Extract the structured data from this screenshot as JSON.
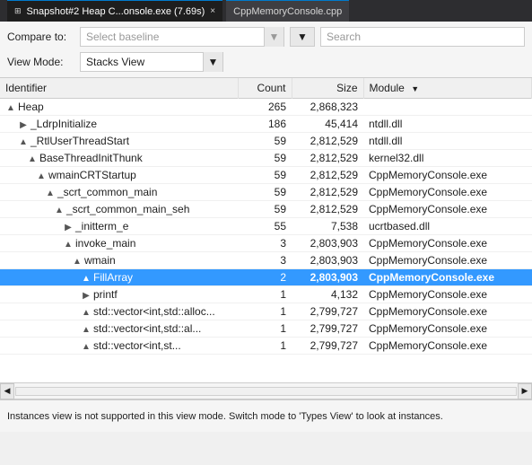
{
  "titlebar": {
    "tab1_label": "Snapshot#2 Heap C...onsole.exe (7.69s)",
    "tab1_pin": "⊞",
    "tab1_close": "×",
    "tab2_label": "CppMemoryConsole.cpp"
  },
  "toolbar": {
    "compare_label": "Compare to:",
    "compare_placeholder": "Select baseline",
    "view_label": "View Mode:",
    "view_value": "Stacks View",
    "search_placeholder": "Search",
    "filter_icon": "▼",
    "dropdown_arrow": "▼"
  },
  "table": {
    "columns": [
      "Identifier",
      "Count",
      "Size",
      "Module"
    ],
    "rows": [
      {
        "indent": 0,
        "expand": "▲",
        "name": "Heap",
        "count": "265",
        "size": "2,868,323",
        "module": "",
        "selected": false
      },
      {
        "indent": 1,
        "expand": "▶",
        "name": "_LdrpInitialize",
        "count": "186",
        "size": "45,414",
        "module": "ntdll.dll",
        "selected": false
      },
      {
        "indent": 1,
        "expand": "▲",
        "name": "_RtlUserThreadStart",
        "count": "59",
        "size": "2,812,529",
        "module": "ntdll.dll",
        "selected": false
      },
      {
        "indent": 2,
        "expand": "▲",
        "name": "BaseThreadInitThunk",
        "count": "59",
        "size": "2,812,529",
        "module": "kernel32.dll",
        "selected": false
      },
      {
        "indent": 3,
        "expand": "▲",
        "name": "wmainCRTStartup",
        "count": "59",
        "size": "2,812,529",
        "module": "CppMemoryConsole.exe",
        "selected": false
      },
      {
        "indent": 4,
        "expand": "▲",
        "name": "_scrt_common_main",
        "count": "59",
        "size": "2,812,529",
        "module": "CppMemoryConsole.exe",
        "selected": false
      },
      {
        "indent": 5,
        "expand": "▲",
        "name": "_scrt_common_main_seh",
        "count": "59",
        "size": "2,812,529",
        "module": "CppMemoryConsole.exe",
        "selected": false
      },
      {
        "indent": 6,
        "expand": "▶",
        "name": "_initterm_e",
        "count": "55",
        "size": "7,538",
        "module": "ucrtbased.dll",
        "selected": false
      },
      {
        "indent": 6,
        "expand": "▲",
        "name": "invoke_main",
        "count": "3",
        "size": "2,803,903",
        "module": "CppMemoryConsole.exe",
        "selected": false
      },
      {
        "indent": 7,
        "expand": "▲",
        "name": "wmain",
        "count": "3",
        "size": "2,803,903",
        "module": "CppMemoryConsole.exe",
        "selected": false
      },
      {
        "indent": 8,
        "expand": "▲",
        "name": "FillArray",
        "count": "2",
        "size": "2,803,903",
        "module": "CppMemoryConsole.exe",
        "selected": true
      },
      {
        "indent": 8,
        "expand": "▶",
        "name": "printf",
        "count": "1",
        "size": "4,132",
        "module": "CppMemoryConsole.exe",
        "selected": false
      },
      {
        "indent": 8,
        "expand": "▲",
        "name": "std::vector<int,std::alloc...",
        "count": "1",
        "size": "2,799,727",
        "module": "CppMemoryConsole.exe",
        "selected": false
      },
      {
        "indent": 8,
        "expand": "▲",
        "name": "std::vector<int,std::al...",
        "count": "1",
        "size": "2,799,727",
        "module": "CppMemoryConsole.exe",
        "selected": false
      },
      {
        "indent": 8,
        "expand": "▲",
        "name": "std::vector<int,st...",
        "count": "1",
        "size": "2,799,727",
        "module": "CppMemoryConsole.exe",
        "selected": false
      }
    ]
  },
  "statusbar": {
    "message": "Instances view is not supported in this view mode. Switch mode to 'Types View' to look at instances."
  }
}
